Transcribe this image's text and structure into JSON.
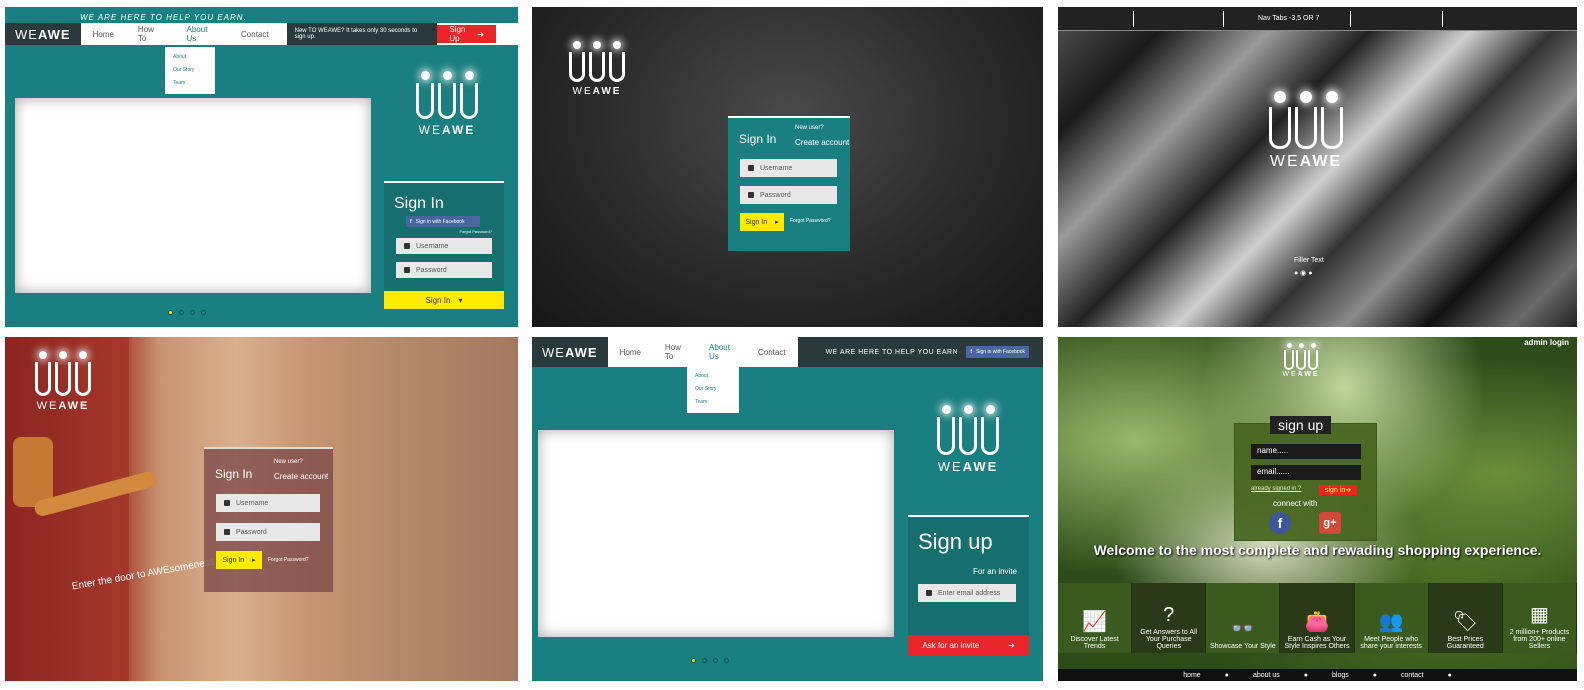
{
  "brand": {
    "we": "WE",
    "awe": "AWE"
  },
  "p1": {
    "tagline": "WE ARE HERE TO HELP YOU EARN.",
    "nav": [
      "Home",
      "How To",
      "About Us",
      "Contact"
    ],
    "dropdown": [
      "About",
      "Our Story",
      "Team"
    ],
    "promo": "New TO WEAWE? It takes only 30 seconds to sign up.",
    "signup_btn": "Sign Up",
    "signin_title": "Sign In",
    "fb_btn": "Sign in with Facebook",
    "forgot": "Forgot Password?",
    "username_ph": "Username",
    "password_ph": "Password",
    "signin_btn": "Sign In"
  },
  "p2": {
    "title": "Sign In",
    "new_user": "New user?",
    "create": "Create account",
    "username_ph": "Username",
    "password_ph": "Password",
    "signin_btn": "Sign In",
    "forgot": "Forgot Password?"
  },
  "p3": {
    "nav_label": "Nav Tabs -3,5 OR 7",
    "filler": "Filler Text"
  },
  "p4": {
    "title": "Sign In",
    "new_user": "New user?",
    "create": "Create account",
    "username_ph": "Username",
    "password_ph": "Password",
    "signin_btn": "Sign In",
    "forgot": "Forgot Password?",
    "door_text": "Enter the door to AWEsomeness"
  },
  "p5": {
    "nav": [
      "Home",
      "How To",
      "About Us",
      "Contact"
    ],
    "dropdown": [
      "About",
      "Our Story",
      "Team"
    ],
    "tagline": "WE ARE HERE TO HELP YOU EARN",
    "fb_btn": "Sign in with Facebook",
    "signup_title": "Sign up",
    "invite_label": "For an invite",
    "email_ph": "Enter email address",
    "ask_btn": "Ask for an invite"
  },
  "p6": {
    "admin": "admin login",
    "signup_title": "sign up",
    "name_ph": "name.....",
    "email_ph": "email......",
    "already": "already signed in ?",
    "signin_btn": "sign in",
    "connect": "connect with",
    "welcome": "Welcome to the most complete and rewading shopping experience.",
    "tiles": [
      {
        "icon": "chart-icon",
        "glyph": "📈",
        "label": "Discover Latest Trends"
      },
      {
        "icon": "question-person-icon",
        "glyph": "?",
        "label": "Get Answers to All Your Purchase Queries"
      },
      {
        "icon": "glasses-icon",
        "glyph": "👓",
        "label": "Showcase Your Style"
      },
      {
        "icon": "wallet-icon",
        "glyph": "👛",
        "label": "Earn Cash as Your Style Inspires Others"
      },
      {
        "icon": "people-icon",
        "glyph": "👥",
        "label": "Meet People who share your interests"
      },
      {
        "icon": "price-tag-icon",
        "glyph": "🏷",
        "label": "Best Prices Guaranteed"
      },
      {
        "icon": "products-icon",
        "glyph": "▦",
        "label": "2 million+ Products from 200+ online Sellers"
      }
    ],
    "footer": [
      "home",
      "about us",
      "blogs",
      "contact"
    ]
  }
}
